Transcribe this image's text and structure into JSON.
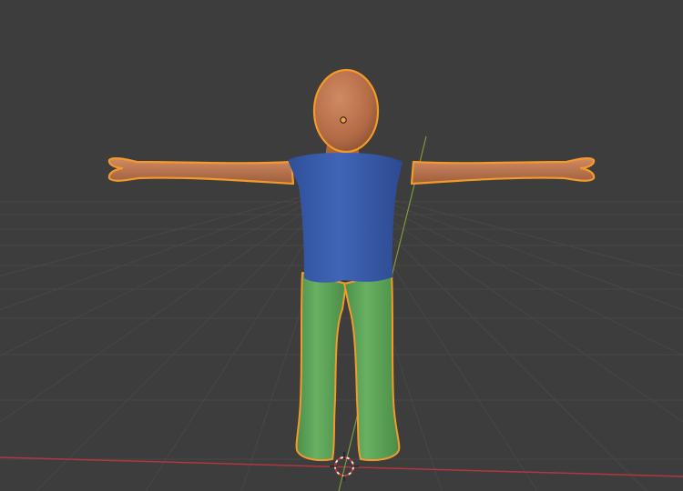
{
  "viewport": {
    "mode": "solid",
    "background": "#3d3d3d",
    "grid_color": "#4a4a4a",
    "x_axis_color": "#b3363f",
    "y_axis_color": "#7c9b3a"
  },
  "scene": {
    "object": "character-mesh",
    "selected": true,
    "outline_color": "#f39a2a",
    "skin_color": "#c67a52",
    "shirt_color": "#3b5fb0",
    "pants_color": "#5da658"
  },
  "cursor_3d": {
    "icon": "3d-cursor-icon"
  }
}
